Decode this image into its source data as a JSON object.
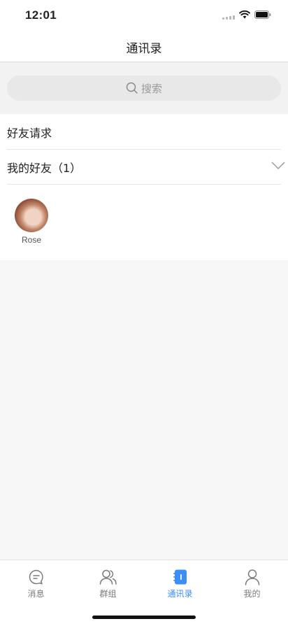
{
  "status_bar": {
    "time": "12:01"
  },
  "nav": {
    "title": "通讯录"
  },
  "search": {
    "placeholder": "搜索"
  },
  "contacts": {
    "friend_requests_label": "好友请求",
    "my_friends_label": "我的好友（1）",
    "friends": [
      {
        "name": "Rose"
      }
    ]
  },
  "tabs": [
    {
      "label": "消息",
      "icon": "message-icon",
      "active": false
    },
    {
      "label": "群组",
      "icon": "group-icon",
      "active": false
    },
    {
      "label": "通讯录",
      "icon": "contacts-book-icon",
      "active": true
    },
    {
      "label": "我的",
      "icon": "profile-icon",
      "active": false
    }
  ],
  "colors": {
    "accent": "#3a8ef6",
    "background": "#f7f7f7",
    "tab_inactive": "#7a7a7a"
  }
}
